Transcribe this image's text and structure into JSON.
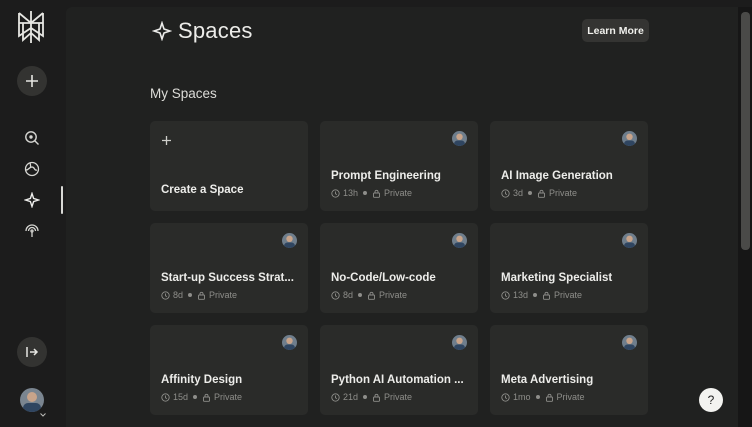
{
  "header": {
    "title": "Spaces",
    "learn_more": "Learn More"
  },
  "section": {
    "title": "My Spaces"
  },
  "create_card": {
    "label": "Create a Space"
  },
  "spaces": [
    {
      "name": "Prompt Engineering",
      "age": "13h",
      "visibility": "Private"
    },
    {
      "name": "AI Image Generation",
      "age": "3d",
      "visibility": "Private"
    },
    {
      "name": "Start-up Success Strat...",
      "age": "8d",
      "visibility": "Private"
    },
    {
      "name": "No-Code/Low-code",
      "age": "8d",
      "visibility": "Private"
    },
    {
      "name": "Marketing Specialist",
      "age": "13d",
      "visibility": "Private"
    },
    {
      "name": "Affinity Design",
      "age": "15d",
      "visibility": "Private"
    },
    {
      "name": "Python AI Automation ...",
      "age": "21d",
      "visibility": "Private"
    },
    {
      "name": "Meta Advertising",
      "age": "1mo",
      "visibility": "Private"
    }
  ],
  "help": {
    "label": "?"
  },
  "icons": {
    "logo": "perplexity-logo-icon",
    "new": "plus-icon",
    "discover": "search-icon",
    "globe": "globe-icon",
    "spaces": "sparkle-icon",
    "library": "broadcast-icon",
    "collapse": "expand-sidebar-icon"
  },
  "colors": {
    "background": "#1c1c1c",
    "panel": "#202120",
    "card": "#2a2b29",
    "text": "#ecece9",
    "muted": "#8e8e8a"
  }
}
